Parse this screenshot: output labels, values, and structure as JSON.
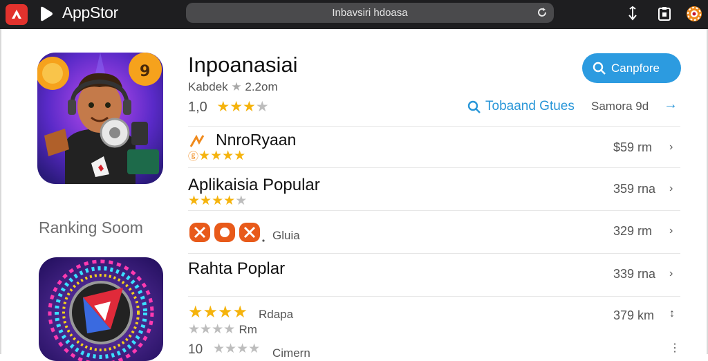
{
  "toolbar": {
    "brand": "AppStor",
    "url": "Inbavsiri hdoasa"
  },
  "app": {
    "title": "Inpoanasiai",
    "meta": "Kabdek",
    "meta_size": "2.2om",
    "rating_value": "1,0",
    "stars": 5,
    "stars_filled": 3
  },
  "actions": {
    "compare_label": "Canpfore",
    "filter_label": "Tobaand Gtues",
    "sort_label": "Samora 9d"
  },
  "sidebar": {
    "ranking_label": "Ranking Soom"
  },
  "rows": [
    {
      "title": "NnroRyaan",
      "size": "$59 rm",
      "stars_filled": 4,
      "stars": 4
    },
    {
      "title": "Aplikaisia Popular",
      "size": "359 rna",
      "stars_filled": 4,
      "stars": 5
    },
    {
      "title": "Gluia",
      "size": "329 rm",
      "stars_filled": 0,
      "stars": 0
    },
    {
      "title": "Rahta Poplar",
      "size": "339 rna",
      "stars_filled": 0,
      "stars": 0
    },
    {
      "title": "Rdapa",
      "size": "379 km",
      "stars_filled": 4,
      "stars": 4
    }
  ],
  "extra": {
    "sub_text": "Rm",
    "footer_value": "10",
    "footer_text": "Cimern"
  },
  "colors": {
    "topbar": "#1e1e20",
    "accent": "#2c9be0",
    "star": "#f5b30c",
    "logo": "#e2322d"
  }
}
